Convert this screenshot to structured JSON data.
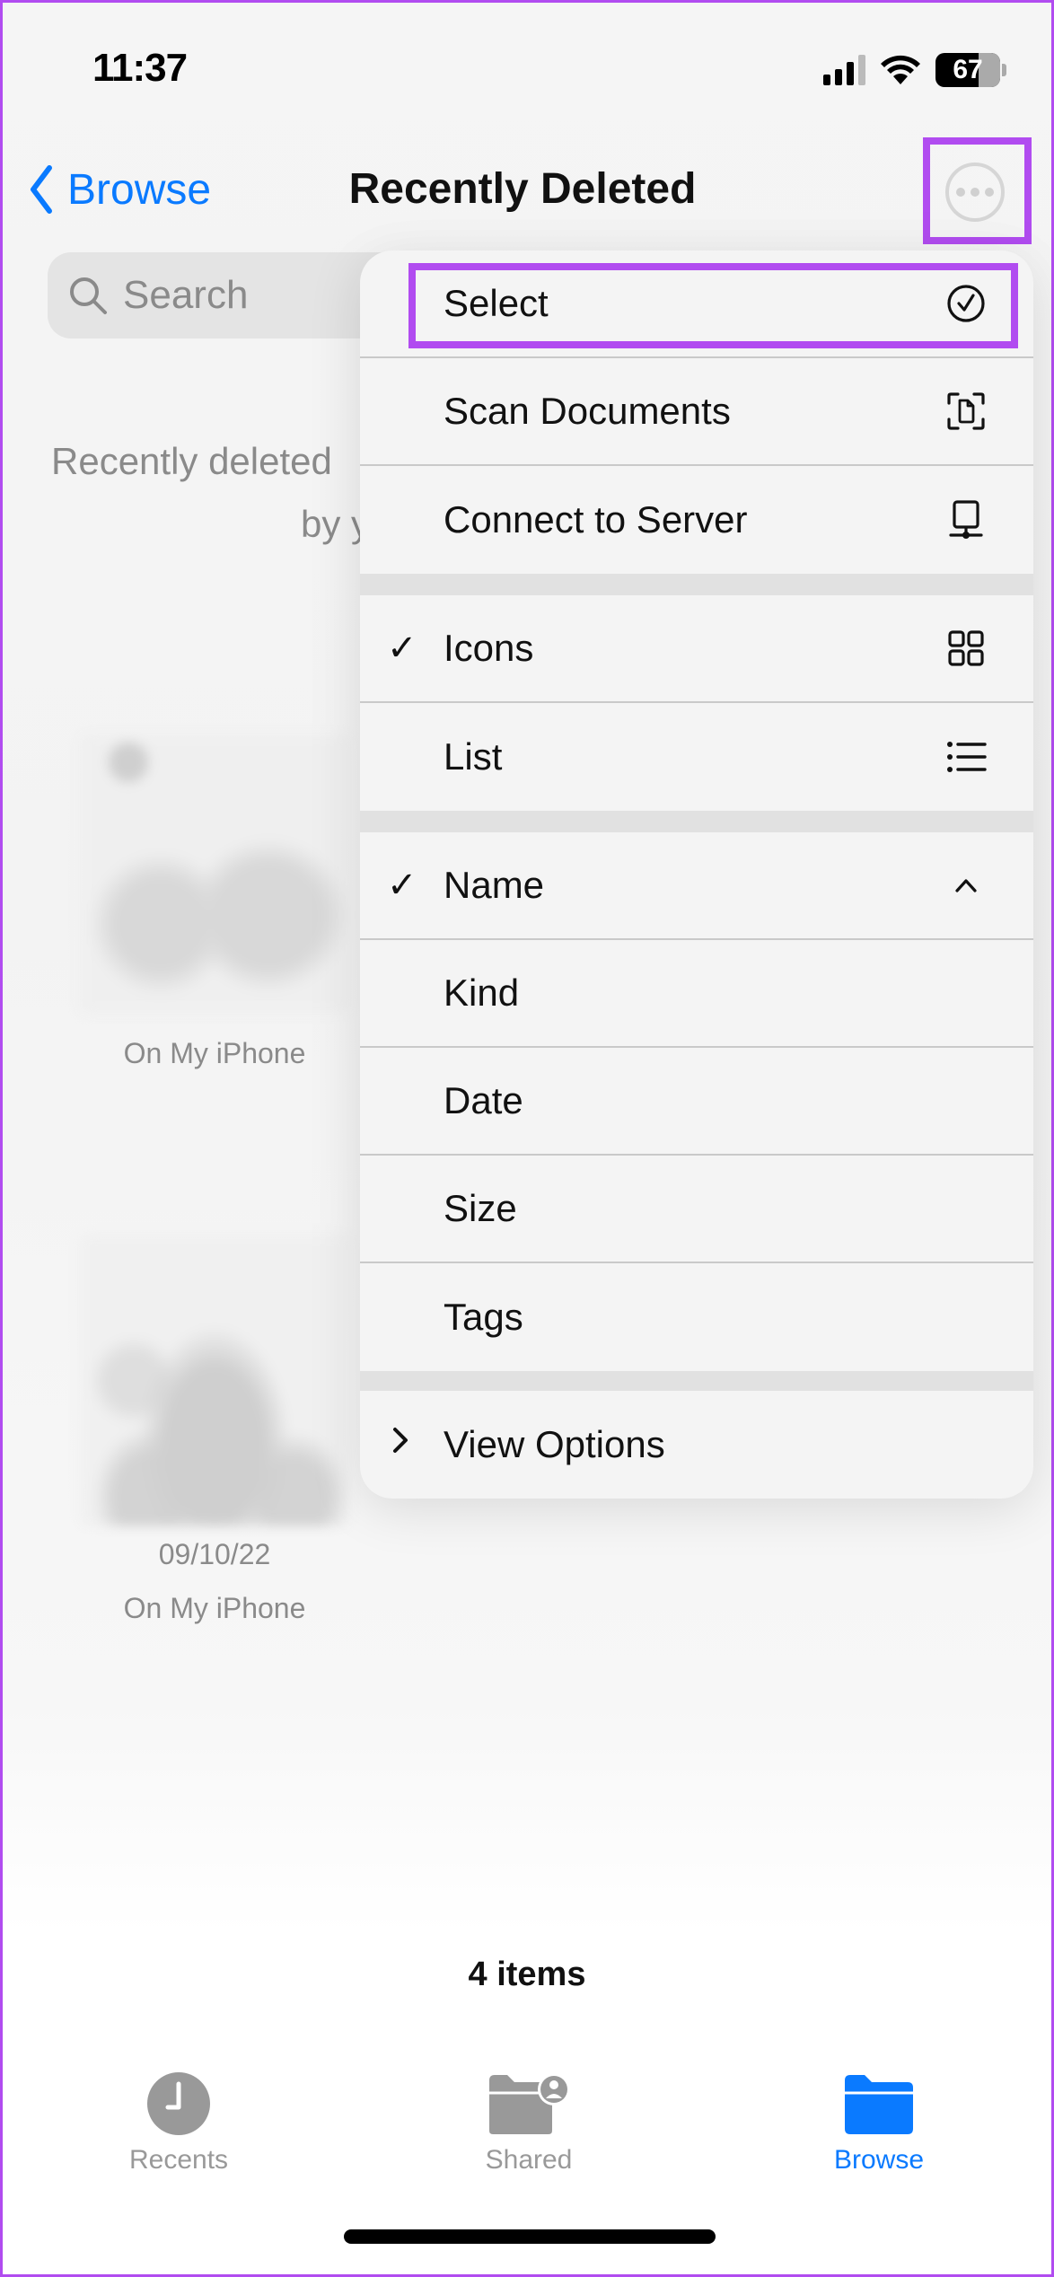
{
  "status_bar": {
    "time": "11:37",
    "battery": "67",
    "icons": [
      "cellular-signal-icon",
      "wifi-icon",
      "battery-icon"
    ]
  },
  "nav": {
    "back_label": "Browse",
    "title": "Recently Deleted",
    "more_icon": "ellipsis-circle-icon"
  },
  "search": {
    "placeholder": "Search"
  },
  "background": {
    "empty_message_line1": "Recently deleted",
    "empty_message_line2": "by y",
    "items": [
      {
        "date": "",
        "location": "On My iPhone"
      },
      {
        "date": "09/10/22",
        "location": "On My iPhone"
      }
    ]
  },
  "menu": {
    "section1": [
      {
        "label": "Select",
        "icon": "checkmark-circle-icon"
      },
      {
        "label": "Scan Documents",
        "icon": "doc-viewfinder-icon"
      },
      {
        "label": "Connect to Server",
        "icon": "server-network-icon"
      }
    ],
    "section2": [
      {
        "label": "Icons",
        "checked": true,
        "icon": "grid-icon"
      },
      {
        "label": "List",
        "checked": false,
        "icon": "list-bullet-icon"
      }
    ],
    "section3": [
      {
        "label": "Name",
        "checked": true,
        "icon": "chevron-up-icon"
      },
      {
        "label": "Kind",
        "checked": false
      },
      {
        "label": "Date",
        "checked": false
      },
      {
        "label": "Size",
        "checked": false
      },
      {
        "label": "Tags",
        "checked": false
      }
    ],
    "section4": [
      {
        "label": "View Options",
        "icon": "chevron-right-icon"
      }
    ],
    "check_glyph": "✓"
  },
  "footer": {
    "item_count": "4 items"
  },
  "tabbar": {
    "tabs": [
      {
        "label": "Recents",
        "icon": "clock-icon",
        "active": false
      },
      {
        "label": "Shared",
        "icon": "shared-folder-icon",
        "active": false
      },
      {
        "label": "Browse",
        "icon": "folder-icon",
        "active": true
      }
    ]
  },
  "colors": {
    "accent": "#0a7aff",
    "highlight": "#b14cf0",
    "inactive": "#999999"
  }
}
